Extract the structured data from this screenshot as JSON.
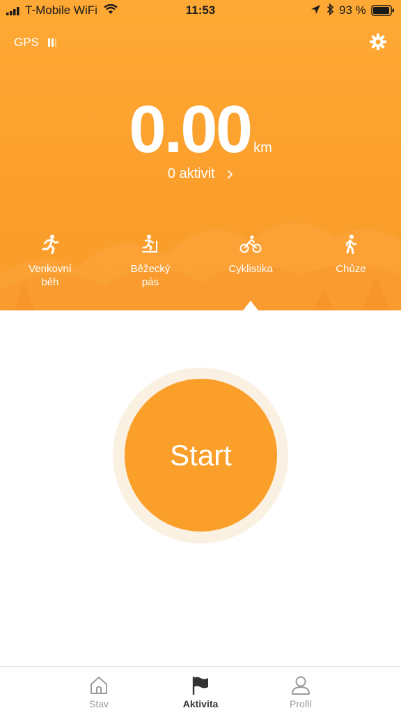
{
  "status_bar": {
    "carrier": "T-Mobile WiFi",
    "time": "11:53",
    "battery": "93 %",
    "icons": [
      "signal-icon",
      "wifi-icon",
      "location-arrow-icon",
      "bluetooth-icon",
      "battery-icon"
    ]
  },
  "top_bar": {
    "gps_label": "GPS",
    "icons": [
      "gps-signal-icon",
      "gear-icon"
    ]
  },
  "summary": {
    "distance": "0.00",
    "unit": "km",
    "activities": "0 aktivit"
  },
  "sport_tabs": [
    {
      "line1": "Venkovní",
      "line2": "běh",
      "icon": "running-icon"
    },
    {
      "line1": "Běžecký",
      "line2": "pás",
      "icon": "treadmill-icon"
    },
    {
      "line1": "Cyklistika",
      "line2": "",
      "icon": "cycling-icon",
      "selected": true
    },
    {
      "line1": "Chůze",
      "line2": "",
      "icon": "walking-icon"
    }
  ],
  "start_label": "Start",
  "bottom_nav": [
    {
      "label": "Stav",
      "icon": "home-icon"
    },
    {
      "label": "Aktivita",
      "icon": "flag-icon",
      "selected": true
    },
    {
      "label": "Profil",
      "icon": "person-icon"
    }
  ],
  "colors": {
    "accent": "#fb9f2b",
    "ring": "#fbf1e2",
    "nav_inactive": "#9a9a9a",
    "nav_active": "#333333"
  }
}
